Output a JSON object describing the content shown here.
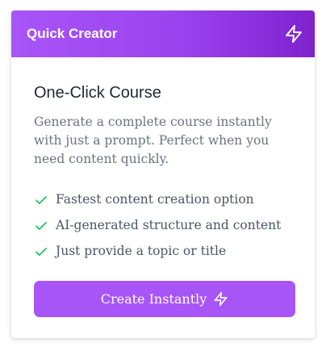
{
  "header": {
    "title": "Quick Creator",
    "icon": "lightning-bolt-icon",
    "gradient": [
      "#a855f7",
      "#7e22ce"
    ]
  },
  "body": {
    "title": "One-Click Course",
    "description": "Generate a complete course instantly with just a prompt. Perfect when you need content quickly.",
    "features": [
      "Fastest content creation option",
      "AI-generated structure and content",
      "Just provide a topic or title"
    ],
    "feature_icon": "check-icon",
    "check_color": "#22c55e"
  },
  "cta": {
    "label": "Create Instantly",
    "icon": "lightning-bolt-icon",
    "color": "#a855f7"
  }
}
